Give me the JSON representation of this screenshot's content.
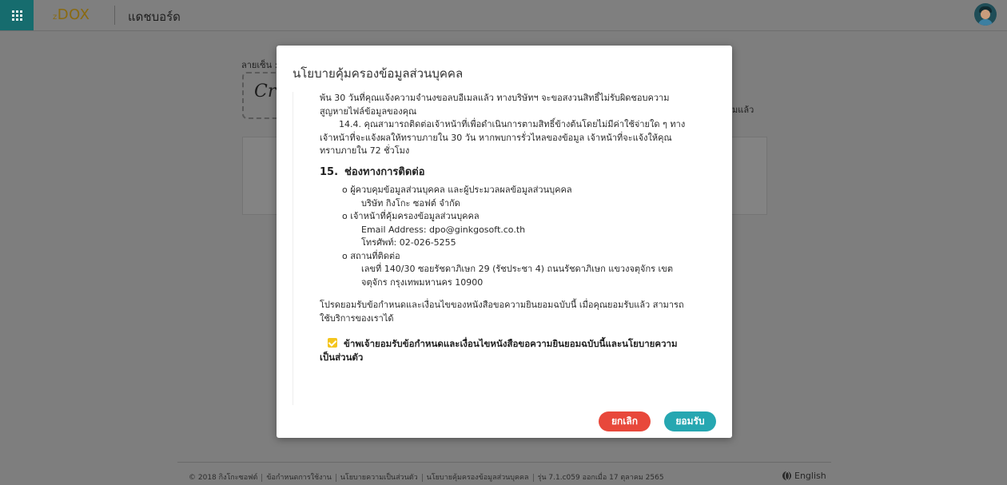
{
  "app": {
    "logo_prefix": "z",
    "logo_name": "DOX",
    "page_title": "แดชบอร์ด"
  },
  "background": {
    "signature_label": "ลายเซ็น :",
    "signature_sample": "Cr",
    "right_text": "มแล้ว"
  },
  "modal": {
    "title": "นโยบายคุ้มครองข้อมูลส่วนบุคคล",
    "cut_line": "... ...",
    "para_a": "พ้น 30 วันที่คุณแจ้งความจำนงขอลบอีเมลแล้ว ทางบริษัทฯ จะขอสงวนสิทธิ์ไม่รับผิดชอบความสูญหายไฟล์ข้อมูลของคุณ",
    "para_b": "14.4. คุณสามารถติดต่อเจ้าหน้าที่เพื่อดำเนินการตามสิทธิ์ข้างต้นโดยไม่มีค่าใช้จ่ายใด ๆ ทางเจ้าหน้าที่จะแจ้งผลให้ทราบภายใน 30 วัน หากพบการรั่วไหลของข้อมูล เจ้าหน้าที่จะแจ้งให้คุณทราบภายใน 72 ชั่วโมง",
    "section_number": "15.",
    "section_title": "ช่องทางการติดต่อ",
    "contact": {
      "controller_label": "o ผู้ควบคุมข้อมูลส่วนบุคคล และผู้ประมวลผลข้อมูลส่วนบุคคล",
      "company": "บริษัท กิงโกะ ซอฟต์ จำกัด",
      "dpo_label": "o เจ้าหน้าที่คุ้มครองข้อมูลส่วนบุคคล",
      "email": "Email Address: dpo@ginkgosoft.co.th",
      "phone": "โทรศัพท์: 02-026-5255",
      "address_label": "o สถานที่ติดต่อ",
      "address": "เลขที่ 140/30 ซอยรัชดาภิเษก 29 (รัชประชา 4) ถนนรัชดาภิเษก แขวงจตุจักร เขตจตุจักร กรุงเทพมหานคร 10900"
    },
    "consent_text": "โปรดยอมรับข้อกำหนดและเงื่อนไขของหนังสือขอความยินยอมฉบับนี้ เมื่อคุณยอมรับแล้ว สามารถใช้บริการของเราได้",
    "agree_text": "ข้าพเจ้ายอมรับข้อกำหนดและเงื่อนไขหนังสือขอความยินยอมฉบับนี้และนโยบายความเป็นส่วนตัว",
    "agree_checked": true,
    "cancel_label": "ยกเลิก",
    "accept_label": "ยอมรับ"
  },
  "footer": {
    "copyright": "© 2018 กิงโกะซอฟต์",
    "terms": "ข้อกำหนดการใช้งาน",
    "privacy": "นโยบายความเป็นส่วนตัว",
    "pdpa": "นโยบายคุ้มครองข้อมูลส่วนบุคคล",
    "version": "รุ่น 7.1.c059 ออกเมื่อ 17 ตุลาคม 2565",
    "language": "English"
  },
  "colors": {
    "brand_teal": "#166c6e",
    "accept": "#26a7b1",
    "cancel": "#e8483b",
    "checkbox": "#f4c51d"
  }
}
